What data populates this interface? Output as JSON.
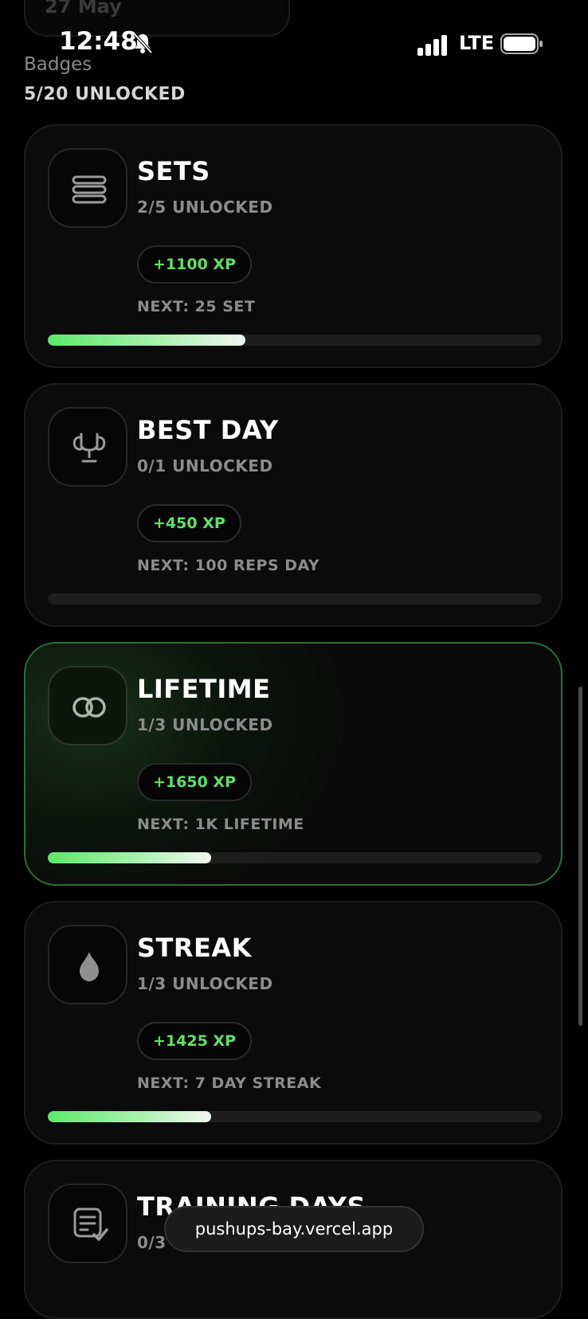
{
  "previous_card_text": "27 May",
  "status_bar": {
    "time": "12:48",
    "network": "LTE"
  },
  "badges": {
    "title": "Badges",
    "unlocked_summary": "5/20 UNLOCKED"
  },
  "cards": [
    {
      "title": "SETS",
      "unlocked": "2/5 UNLOCKED",
      "xp": "+1100 XP",
      "next": "NEXT: 25 SET",
      "progress": 0.4,
      "icon": "stack-icon",
      "active": false
    },
    {
      "title": "BEST DAY",
      "unlocked": "0/1 UNLOCKED",
      "xp": "+450 XP",
      "next": "NEXT: 100 REPS DAY",
      "progress": 0.0,
      "icon": "trophy-icon",
      "active": false
    },
    {
      "title": "LIFETIME",
      "unlocked": "1/3 UNLOCKED",
      "xp": "+1650 XP",
      "next": "NEXT: 1K LIFETIME",
      "progress": 0.33,
      "icon": "infinity-rings-icon",
      "active": true
    },
    {
      "title": "STREAK",
      "unlocked": "1/3 UNLOCKED",
      "xp": "+1425 XP",
      "next": "NEXT: 7 DAY STREAK",
      "progress": 0.33,
      "icon": "flame-icon",
      "active": false
    },
    {
      "title": "TRAINING DAYS",
      "unlocked": "0/3 UNLOCKED",
      "icon": "checklist-icon",
      "active": false
    }
  ],
  "browser": {
    "url": "pushups-bay.vercel.app"
  },
  "colors": {
    "accent_green": "#5fe06a",
    "active_border": "#2f6d36",
    "card_bg": "#0b0b0b"
  }
}
